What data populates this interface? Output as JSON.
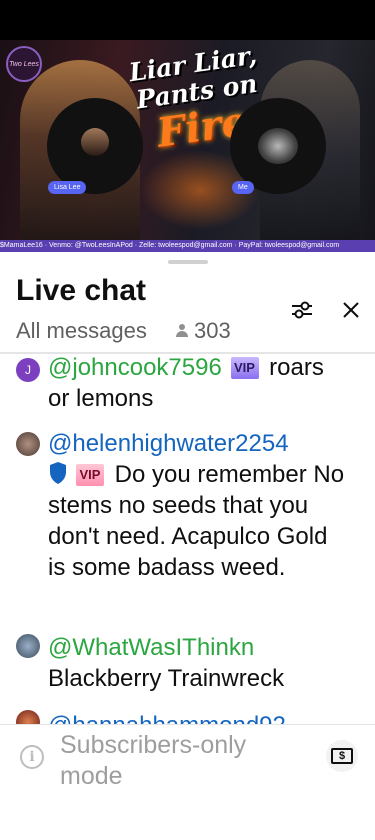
{
  "stream": {
    "title_line1": "Liar Liar,",
    "title_line2": "Pants on",
    "title_fire": "Fire",
    "logo_text": "Two Lees",
    "guest_left_label": "Lisa Lee",
    "guest_right_label": "Me",
    "ticker": "$MamaLee16 · Venmo: @TwoLeesInAPod · Zelle: twoleespod@gmail.com · PayPal: twoleespod@gmail.com"
  },
  "chat": {
    "title": "Live chat",
    "filter": "All messages",
    "viewer_count": "303"
  },
  "messages": [
    {
      "avatar_letter": "J",
      "avatar_color": "#7b3fbf",
      "author": "@johncook7596",
      "badge": "VIP",
      "text": "roars or lemons"
    },
    {
      "avatar_color": "#6a5a50",
      "author": "@helenhighwater2254",
      "badge": "VIP",
      "text": "Do you remember No stems no seeds that you don't need. Acapulco Gold is some badass weed."
    },
    {
      "avatar_color": "#4a6a8a",
      "author": "@WhatWasIThinkn",
      "text": "Blackberry Trainwreck"
    },
    {
      "avatar_color": "#a04030",
      "author": "@hannahhammond92"
    }
  ],
  "footer": {
    "subscribers_only": "Subscribers-only mode"
  },
  "colors": {
    "author_green": "#2ba640",
    "author_blue": "#1565c0",
    "ticker_bg": "#5a3fb0"
  }
}
